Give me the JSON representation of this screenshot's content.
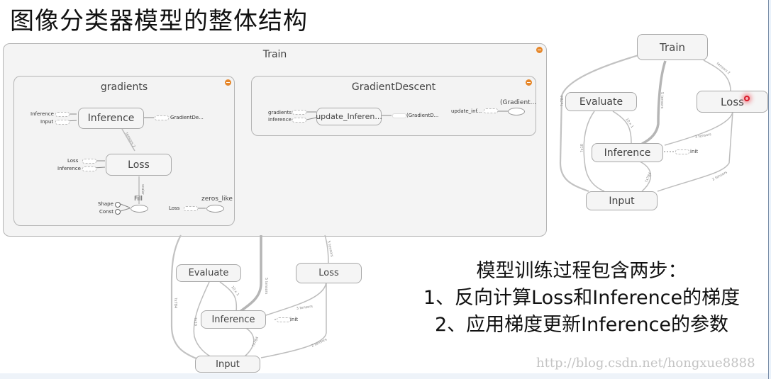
{
  "title": "图像分类器模型的整体结构",
  "train_group": {
    "title": "Train",
    "gradients_group": {
      "title": "gradients",
      "nodes": {
        "inference": "Inference",
        "loss": "Loss",
        "fill": "Fill",
        "zeros_like": "zeros_like"
      },
      "inference_inputs": [
        "Inference",
        "Input"
      ],
      "inference_output": "GradientDe...",
      "loss_inputs": [
        "Loss",
        "Inference"
      ],
      "fill_inputs": [
        "Shape",
        "Const"
      ],
      "zeros_like_input": "Loss",
      "edge_inference_loss": "tensors 2",
      "edge_loss_fill": "scalar"
    },
    "gradient_descent_group": {
      "title": "GradientDescent",
      "nodes": {
        "update": "update_Inferen...",
        "output": "(Gradient..."
      },
      "update_inputs": [
        "gradients",
        "Inference"
      ],
      "update_output": "(GradientD...",
      "output_input": "update_inf..."
    }
  },
  "bottom_graph": {
    "nodes": {
      "evaluate": "Evaluate",
      "loss": "Loss",
      "inference": "Inference",
      "input": "Input",
      "init": "init"
    },
    "edges": {
      "train_inference": "5 tensors",
      "train_loss": "5 tensors",
      "evaluate_inference": "10 x 1",
      "input_evaluate_left": "?x784",
      "input_evaluate": "?x10",
      "inference_input": "?x784",
      "loss_inference": "3 tensors",
      "loss_input": "2 tensors"
    }
  },
  "right_graph": {
    "nodes": {
      "train": "Train",
      "evaluate": "Evaluate",
      "loss": "Loss",
      "inference": "Inference",
      "input": "Input",
      "init": "init"
    },
    "edges": {
      "train_inference": "5 tensors",
      "train_loss": "tensors 2",
      "train_input": "?x784",
      "evaluate_inference": "10 x 1",
      "input_evaluate": "?x10",
      "inference_input": "?x784",
      "loss_inference": "3 tensors",
      "loss_input": "2 tensors"
    }
  },
  "summary": {
    "heading": "模型训练过程包含两步：",
    "step1": "1、反向计算Loss和Inference的梯度",
    "step2": "2、应用梯度更新Inference的参数"
  },
  "watermark": "http://blog.csdn.net/hongxue8888",
  "colors": {
    "collapse_button": "#e6872a",
    "selection_dot": "#d91b2c",
    "group_bg": "#f4f4f4",
    "node_border": "#a8a8a8"
  }
}
